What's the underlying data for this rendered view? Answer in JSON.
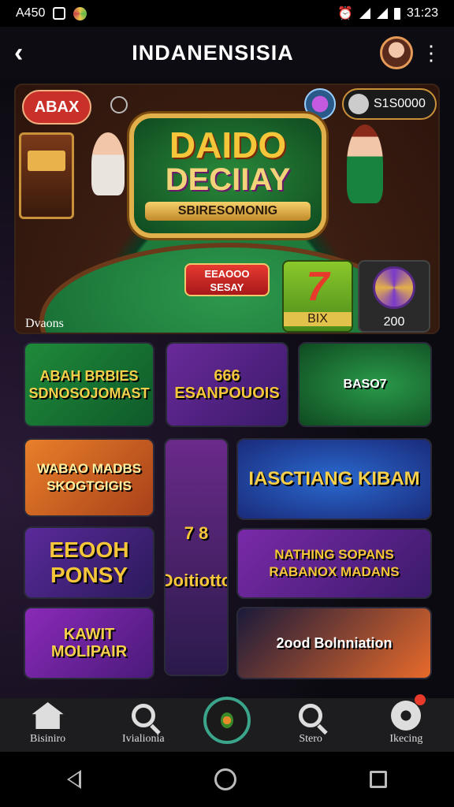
{
  "status_bar": {
    "left_text": "A450",
    "time": "31:23"
  },
  "app_bar": {
    "title": "INDANENSISIA"
  },
  "hero": {
    "badge": "ABAX",
    "balance": "S1S0000",
    "logo_line1": "DAIDO",
    "logo_line2": "DECIIAY",
    "logo_line3": "SBIRESOMONIG",
    "button_line1": "EEAOOO",
    "button_line2": "SESAY",
    "tile_number": "7",
    "tile_label": "BIX",
    "tile_wheel_label": "200",
    "section_label": "Dvaons"
  },
  "cards": [
    {
      "text": "ABAH BRBIES SDNOSOJOMAST"
    },
    {
      "text": "666 ESANPOUOIS"
    },
    {
      "text": "BASO7"
    },
    {
      "text": "WABAO MADBS SKOGTGIGIS"
    },
    {
      "text": "7 8 Doitiotto"
    },
    {
      "text": "IASCTIANG KIBAM"
    },
    {
      "text": "EEOOH PONSY"
    },
    {
      "text": "NATHING SOPANS RABANOX MADANS"
    },
    {
      "text": "KAWIT MOLIPAIR"
    },
    {
      "text": "2ood Bolnniation"
    }
  ],
  "bottom_nav": [
    {
      "label": "Bisiniro",
      "icon": "home-icon"
    },
    {
      "label": "Ivialionia",
      "icon": "search-icon"
    },
    {
      "label": "Stero",
      "icon": "search-icon"
    },
    {
      "label": "Ikecing",
      "icon": "gear-icon"
    }
  ]
}
